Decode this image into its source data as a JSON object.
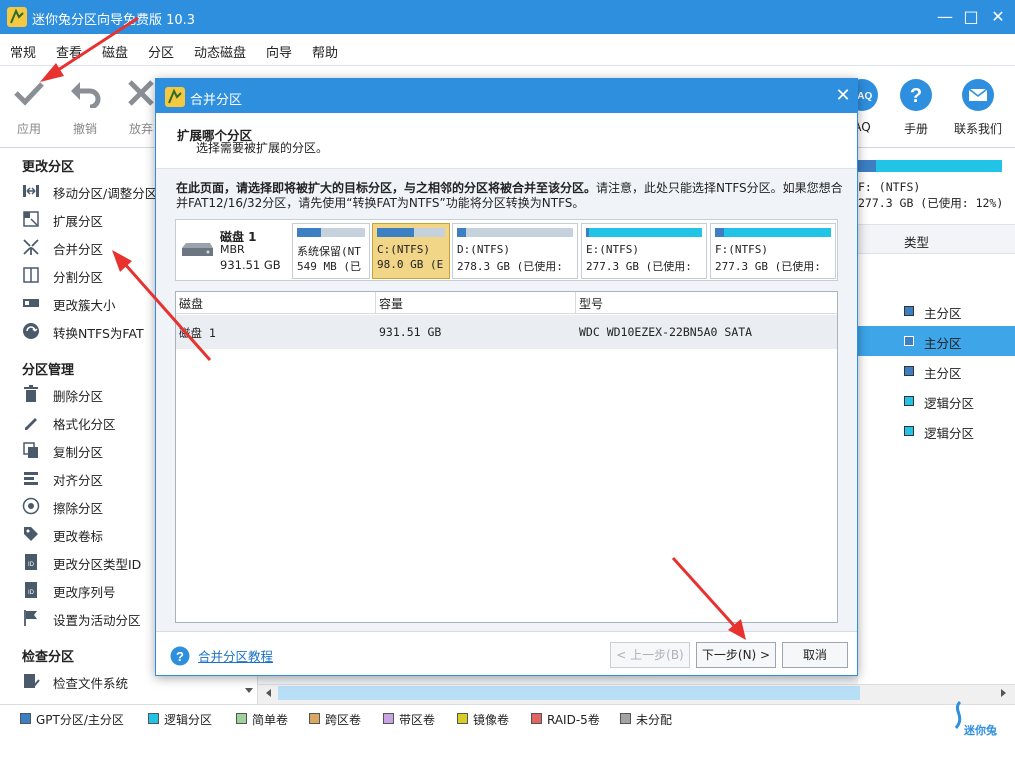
{
  "app": {
    "title": "迷你兔分区向导免费版 10.3",
    "min_glyph": "—",
    "max_glyph": "□",
    "close_glyph": "✕"
  },
  "menu": [
    "常规",
    "查看",
    "磁盘",
    "分区",
    "动态磁盘",
    "向导",
    "帮助"
  ],
  "toolbar": {
    "apply": "应用",
    "undo": "撤销",
    "discard": "放弃",
    "faq": "AQ",
    "manual": "手册",
    "contact": "联系我们"
  },
  "sidebar": {
    "sections": [
      {
        "header": "更改分区",
        "items": [
          {
            "label": "移动分区/调整分区",
            "icon": "move-resize-icon"
          },
          {
            "label": "扩展分区",
            "icon": "extend-icon"
          },
          {
            "label": "合并分区",
            "icon": "merge-icon"
          },
          {
            "label": "分割分区",
            "icon": "split-icon"
          },
          {
            "label": "更改簇大小",
            "icon": "cluster-icon"
          },
          {
            "label": "转换NTFS为FAT",
            "icon": "convert-icon"
          }
        ]
      },
      {
        "header": "分区管理",
        "items": [
          {
            "label": "删除分区",
            "icon": "trash-icon"
          },
          {
            "label": "格式化分区",
            "icon": "pen-icon"
          },
          {
            "label": "复制分区",
            "icon": "copy-icon"
          },
          {
            "label": "对齐分区",
            "icon": "align-icon"
          },
          {
            "label": "擦除分区",
            "icon": "wipe-icon"
          },
          {
            "label": "更改卷标",
            "icon": "tag-icon"
          },
          {
            "label": "更改分区类型ID",
            "icon": "id-icon"
          },
          {
            "label": "更改序列号",
            "icon": "id-icon"
          },
          {
            "label": "设置为活动分区",
            "icon": "flag-icon"
          }
        ]
      },
      {
        "header": "检查分区",
        "items": [
          {
            "label": "检查文件系统",
            "icon": "check-fs-icon"
          }
        ]
      }
    ]
  },
  "right_pane": {
    "partition_name": "F: (NTFS)",
    "partition_size": "277.3 GB (已使用: 12%)",
    "column_header": "类型",
    "rows": [
      {
        "label": "主分区",
        "color": "#3c7fc3",
        "selected": false
      },
      {
        "label": "主分区",
        "color": "#3c7fc3",
        "selected": true
      },
      {
        "label": "主分区",
        "color": "#3c7fc3",
        "selected": false
      },
      {
        "label": "逻辑分区",
        "color": "#21c3e6",
        "selected": false
      },
      {
        "label": "逻辑分区",
        "color": "#21c3e6",
        "selected": false
      }
    ]
  },
  "legend": [
    {
      "label": "GPT分区/主分区",
      "color": "#3c7fc3"
    },
    {
      "label": "逻辑分区",
      "color": "#21c3e6"
    },
    {
      "label": "简单卷",
      "color": "#9fd19a"
    },
    {
      "label": "跨区卷",
      "color": "#d8a863"
    },
    {
      "label": "带区卷",
      "color": "#c8a5e0"
    },
    {
      "label": "镜像卷",
      "color": "#d9cc24"
    },
    {
      "label": "RAID-5卷",
      "color": "#e26565"
    },
    {
      "label": "未分配",
      "color": "#a3a3a3"
    }
  ],
  "brand": "迷你兔",
  "dialog": {
    "title": "合并分区",
    "heading": "扩展哪个分区",
    "subheading": "选择需要被扩展的分区。",
    "desc_bold": "在此页面，请选择即将被扩大的目标分区，与之相邻的分区将被合并至该分区。",
    "desc_rest": "请注意，此处只能选择NTFS分区。如果您想合并FAT12/16/32分区，请先使用“转换FAT为NTFS”功能将分区转换为NTFS。",
    "disk": {
      "name": "磁盘 1",
      "type": "MBR",
      "size": "931.51 GB"
    },
    "partitions": [
      {
        "name": "系统保留(NT",
        "size": "549 MB (已",
        "used": 0.35,
        "color": "#3c7fc3",
        "selected": false
      },
      {
        "name": "C:(NTFS)",
        "size": "98.0 GB (E",
        "used": 0.55,
        "color": "#3c7fc3",
        "selected": true
      },
      {
        "name": "D:(NTFS)",
        "size": "278.3 GB (已使用:",
        "used": 0.08,
        "color": "#3c7fc3",
        "selected": false
      },
      {
        "name": "E:(NTFS)",
        "size": "277.3 GB (已使用:",
        "used": 0.03,
        "color": "#21c3e6",
        "selected": false
      },
      {
        "name": "F:(NTFS)",
        "size": "277.3 GB (已使用:",
        "used": 0.08,
        "color": "#21c3e6",
        "selected": false
      }
    ],
    "table": {
      "headers": [
        "磁盘",
        "容量",
        "型号"
      ],
      "rows": [
        {
          "disk": "磁盘 1",
          "capacity": "931.51 GB",
          "model": "WDC WD10EZEX-22BN5A0 SATA"
        }
      ]
    },
    "help_link": "合并分区教程",
    "btn_back": "< 上一步(B)",
    "btn_next": "下一步(N) >",
    "btn_cancel": "取消"
  }
}
